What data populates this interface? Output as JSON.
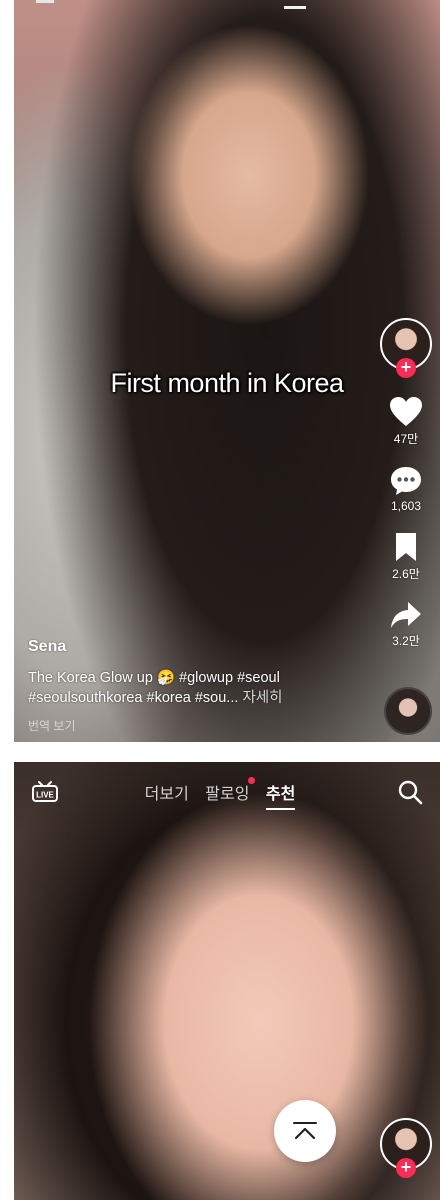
{
  "feed": [
    {
      "overlay_caption": "First month in Korea",
      "author": "Sena",
      "description": "The Korea Glow up 🤧 #glowup #seoul #seoulsouthkorea #korea #sou...",
      "more_label": "자세히",
      "translate_label": "번역 보기",
      "actions": {
        "like_count": "47만",
        "comment_count": "1,603",
        "save_count": "2.6만",
        "share_count": "3.2만"
      },
      "icons": [
        "heart-icon",
        "comment-icon",
        "bookmark-icon",
        "share-icon",
        "plus-icon"
      ]
    }
  ],
  "topbar": {
    "live_label": "LIVE",
    "tabs": [
      "더보기",
      "팔로잉",
      "추천"
    ],
    "active_tab": "추천"
  },
  "colors": {
    "accent": "#fe2c55",
    "text": "#ffffff"
  }
}
